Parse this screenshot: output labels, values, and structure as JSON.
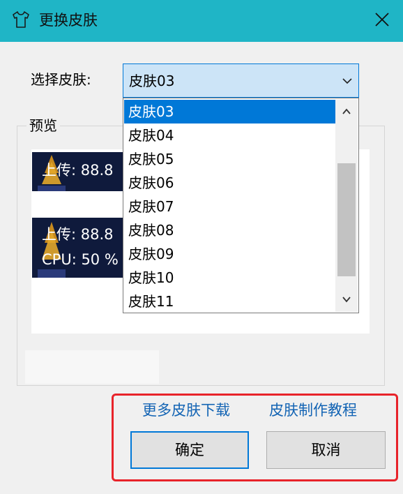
{
  "window": {
    "title": "更换皮肤",
    "icon": "tshirt-icon",
    "close_icon": "close-icon",
    "accent_color": "#1fb5c6"
  },
  "skin_select": {
    "label": "选择皮肤:",
    "selected_value": "皮肤03",
    "arrow_icon": "chevron-down-icon"
  },
  "dropdown": {
    "items": [
      "皮肤03",
      "皮肤04",
      "皮肤05",
      "皮肤06",
      "皮肤07",
      "皮肤08",
      "皮肤09",
      "皮肤10",
      "皮肤11"
    ],
    "selected_index": 0,
    "scroll_up_icon": "chevron-up-icon",
    "scroll_down_icon": "chevron-down-icon",
    "selection_color": "#0078d7"
  },
  "preview": {
    "label": "预览",
    "thumb1": {
      "line1": "上传: 88.8"
    },
    "thumb2": {
      "line1": "上传: 88.8",
      "line2": "CPU: 50 %"
    }
  },
  "links": {
    "more_skins": "更多皮肤下载",
    "tutorial": "皮肤制作教程"
  },
  "buttons": {
    "ok": "确定",
    "cancel": "取消"
  },
  "highlight_color": "#e8232a"
}
